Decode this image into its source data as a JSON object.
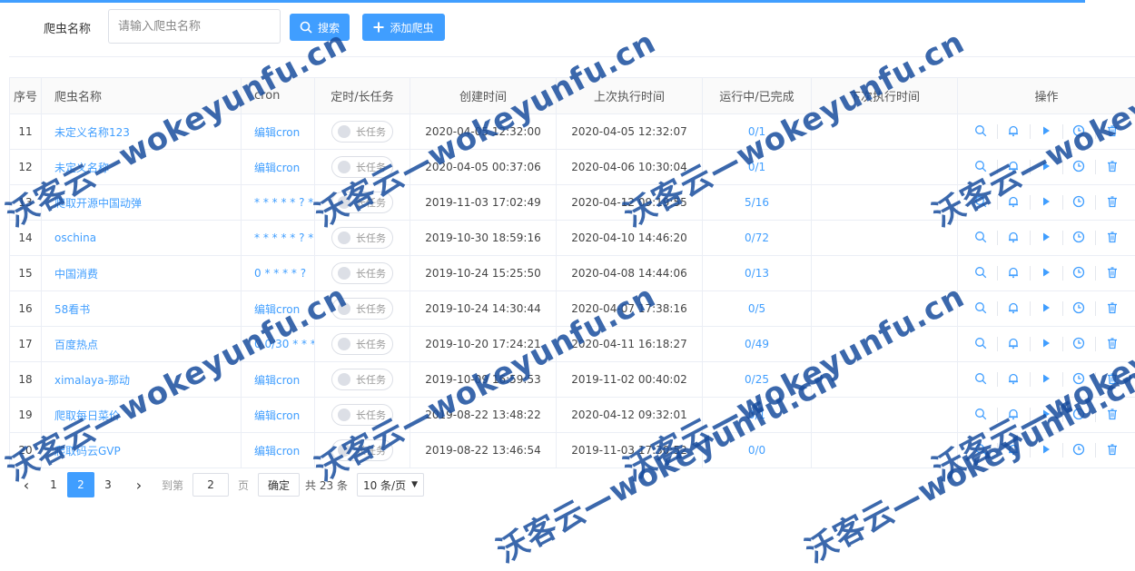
{
  "toolbar": {
    "name_label": "爬虫名称",
    "name_placeholder": "请输入爬虫名称",
    "search_label": "搜索",
    "add_label": "添加爬虫"
  },
  "table": {
    "headers": {
      "index": "序号",
      "name": "爬虫名称",
      "cron": "cron",
      "type": "定时/长任务",
      "created": "创建时间",
      "last_run": "上次执行时间",
      "progress": "运行中/已完成",
      "next_run": "下次执行时间",
      "ops": "操作"
    },
    "rows": [
      {
        "index": "11",
        "name": "未定义名称123",
        "cron": "编辑cron",
        "toggle": "长任务",
        "created": "2020-04-05 12:32:00",
        "last_run": "2020-04-05 12:32:07",
        "progress": "0/1",
        "next_run": ""
      },
      {
        "index": "12",
        "name": "未定义名称",
        "cron": "编辑cron",
        "toggle": "长任务",
        "created": "2020-04-05 00:37:06",
        "last_run": "2020-04-06 10:30:04",
        "progress": "0/1",
        "next_run": ""
      },
      {
        "index": "13",
        "name": "爬取开源中国动弹",
        "cron": "* * * * * ? * ...",
        "toggle": "长任务",
        "created": "2019-11-03 17:02:49",
        "last_run": "2020-04-12 09:19:55",
        "progress": "5/16",
        "next_run": ""
      },
      {
        "index": "14",
        "name": "oschina",
        "cron": "* * * * * ? * ...",
        "toggle": "长任务",
        "created": "2019-10-30 18:59:16",
        "last_run": "2020-04-10 14:46:20",
        "progress": "0/72",
        "next_run": ""
      },
      {
        "index": "15",
        "name": "中国消费",
        "cron": "0 * * * * ?",
        "toggle": "长任务",
        "created": "2019-10-24 15:25:50",
        "last_run": "2020-04-08 14:44:06",
        "progress": "0/13",
        "next_run": ""
      },
      {
        "index": "16",
        "name": "58看书",
        "cron": "编辑cron",
        "toggle": "长任务",
        "created": "2019-10-24 14:30:44",
        "last_run": "2020-04-07 17:38:16",
        "progress": "0/5",
        "next_run": ""
      },
      {
        "index": "17",
        "name": "百度热点",
        "cron": "0 0/30 * * * ?",
        "toggle": "长任务",
        "created": "2019-10-20 17:24:21",
        "last_run": "2020-04-11 16:18:27",
        "progress": "0/49",
        "next_run": ""
      },
      {
        "index": "18",
        "name": "ximalaya-那动",
        "cron": "编辑cron",
        "toggle": "长任务",
        "created": "2019-10-09 16:59:53",
        "last_run": "2019-11-02 00:40:02",
        "progress": "0/25",
        "next_run": ""
      },
      {
        "index": "19",
        "name": "爬取每日菜价",
        "cron": "编辑cron",
        "toggle": "长任务",
        "created": "2019-08-22 13:48:22",
        "last_run": "2020-04-12 09:32:01",
        "progress": "0/1",
        "next_run": ""
      },
      {
        "index": "20",
        "name": "爬取码云GVP",
        "cron": "编辑cron",
        "toggle": "长任务",
        "created": "2019-08-22 13:46:54",
        "last_run": "2019-11-03 17:30:52",
        "progress": "0/0",
        "next_run": ""
      }
    ],
    "op_icons": [
      "search-icon",
      "bell-icon",
      "play-icon",
      "clock-icon",
      "trash-icon"
    ]
  },
  "pager": {
    "prev": "‹",
    "pages": [
      "1",
      "2",
      "3"
    ],
    "active_page": "2",
    "next": "›",
    "goto_label": "到第",
    "goto_value": "2",
    "page_unit": "页",
    "confirm": "确定",
    "total": "共 23 条",
    "page_size": "10 条/页"
  },
  "watermark": "沃客云—wokeyunfu.cn",
  "colors": {
    "primary": "#409eff",
    "watermark": "#1a4e9e"
  }
}
